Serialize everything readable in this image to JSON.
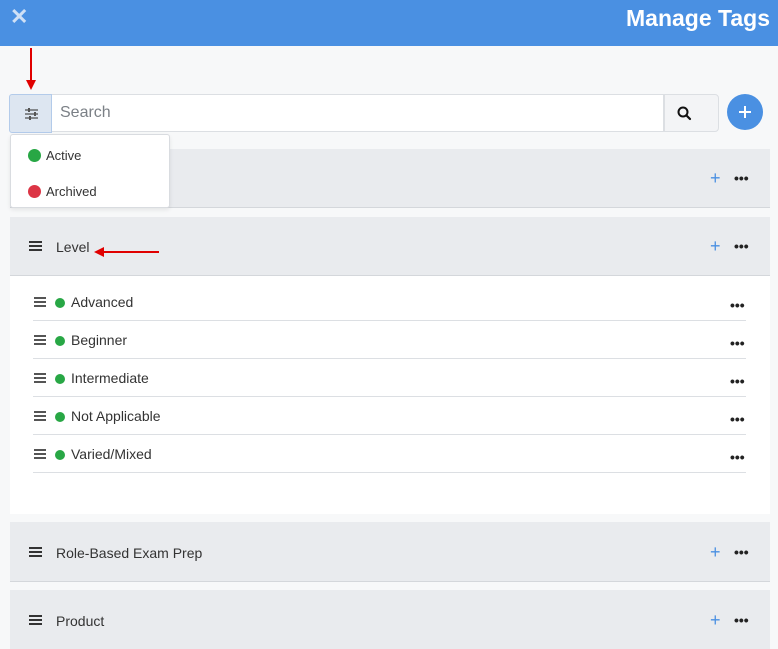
{
  "header": {
    "title": "Manage Tags",
    "close_icon": "close-icon"
  },
  "search": {
    "placeholder": "Search",
    "value": ""
  },
  "filter_dropdown": {
    "options": [
      {
        "label": "Active",
        "color": "#28a745"
      },
      {
        "label": "Archived",
        "color": "#dc3545"
      }
    ]
  },
  "groups": [
    {
      "label": ""
    },
    {
      "label": "Level"
    },
    {
      "label": "Role-Based Exam Prep"
    },
    {
      "label": "Product"
    }
  ],
  "level_items": [
    {
      "label": "Advanced",
      "status_color": "#28a745"
    },
    {
      "label": "Beginner",
      "status_color": "#28a745"
    },
    {
      "label": "Intermediate",
      "status_color": "#28a745"
    },
    {
      "label": "Not Applicable",
      "status_color": "#28a745"
    },
    {
      "label": "Varied/Mixed",
      "status_color": "#28a745"
    }
  ],
  "colors": {
    "accent": "#4a90e2",
    "active": "#28a745",
    "archived": "#dc3545",
    "annotation": "#e00000"
  }
}
